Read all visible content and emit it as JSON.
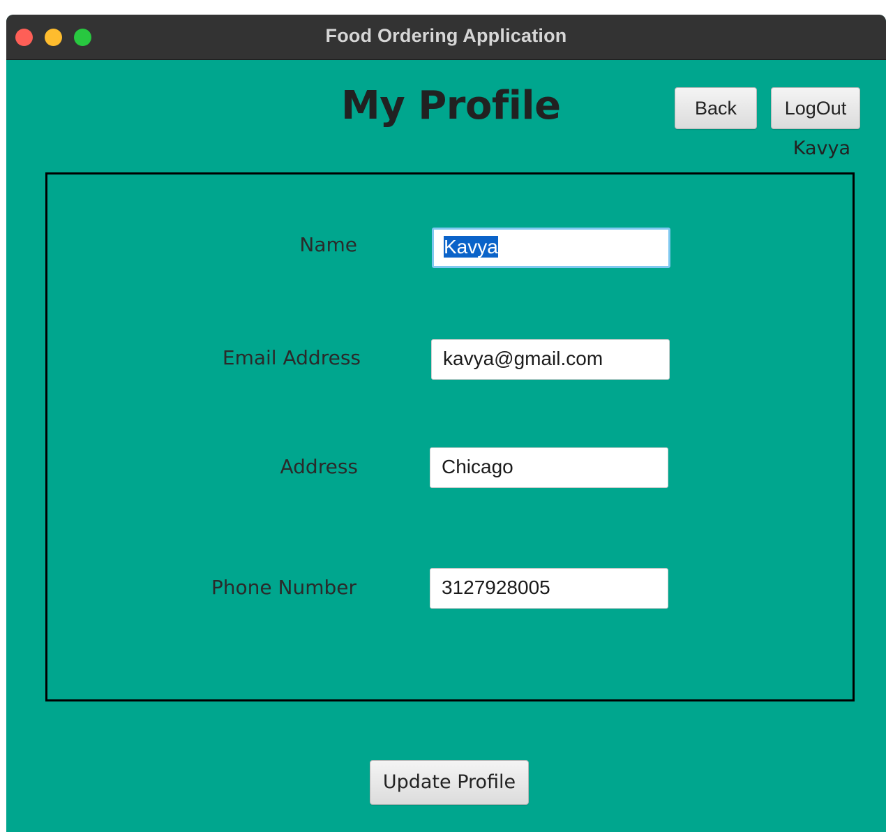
{
  "window": {
    "title": "Food Ordering Application"
  },
  "header": {
    "page_title": "My Profile",
    "back_label": "Back",
    "logout_label": "LogOut",
    "username": "Kavya"
  },
  "form": {
    "name_label": "Name",
    "name_value": "Kavya",
    "email_label": "Email Address",
    "email_value": "kavya@gmail.com",
    "address_label": "Address",
    "address_value": "Chicago",
    "phone_label": "Phone Number",
    "phone_value": "3127928005"
  },
  "footer": {
    "update_label": "Update Profile"
  },
  "colors": {
    "background": "#00a68e",
    "titlebar": "#333333",
    "selection": "#0a63c9"
  }
}
